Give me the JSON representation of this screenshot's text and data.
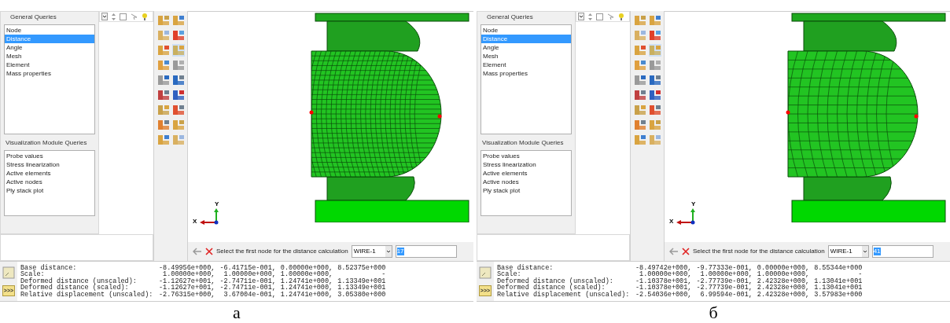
{
  "panels": [
    {
      "caption": "а",
      "general_queries": {
        "title": "General Queries",
        "items": [
          {
            "label": "Node",
            "selected": false
          },
          {
            "label": "Distance",
            "selected": true
          },
          {
            "label": "Angle",
            "selected": false
          },
          {
            "label": "Mesh",
            "selected": false
          },
          {
            "label": "Element",
            "selected": false
          },
          {
            "label": "Mass properties",
            "selected": false
          }
        ]
      },
      "visualization_queries": {
        "title": "Visualization Module Queries",
        "items": [
          {
            "label": "Probe values"
          },
          {
            "label": "Stress linearization"
          },
          {
            "label": "Active elements"
          },
          {
            "label": "Active nodes"
          },
          {
            "label": "Ply stack plot"
          }
        ]
      },
      "axes": {
        "x": "X",
        "y": "Y"
      },
      "prompt": {
        "text": "Select the first node for the distance calculation",
        "dropdown": "WIRE-1",
        "input": "17"
      },
      "output_button": ">>>",
      "output": [
        {
          "label": "Base distance:",
          "values": [
            "-8.49956e+000,",
            "-6.41715e-001,",
            "0.00000e+000,",
            "8.52375e+000"
          ]
        },
        {
          "label": "Scale:",
          "values": [
            "1.00000e+000,",
            "1.00000e+000,",
            "1.00000e+000,",
            "-"
          ]
        },
        {
          "label": "Deformed distance (unscaled):",
          "values": [
            "-1.12627e+001,",
            "-2.74711e-001,",
            "1.24741e+000,",
            "1.13349e+001"
          ]
        },
        {
          "label": "Deformed distance (scaled):",
          "values": [
            "-1.12627e+001,",
            "-2.74711e-001,",
            "1.24741e+000,",
            "1.13349e+001"
          ]
        },
        {
          "label": "Relative displacement (unscaled):",
          "values": [
            "-2.76315e+000,",
            "3.67004e-001,",
            "1.24741e+000,",
            "3.05380e+000"
          ]
        }
      ]
    },
    {
      "caption": "б",
      "general_queries": {
        "title": "General Queries",
        "items": [
          {
            "label": "Node",
            "selected": false
          },
          {
            "label": "Distance",
            "selected": true
          },
          {
            "label": "Angle",
            "selected": false
          },
          {
            "label": "Mesh",
            "selected": false
          },
          {
            "label": "Element",
            "selected": false
          },
          {
            "label": "Mass properties",
            "selected": false
          }
        ]
      },
      "visualization_queries": {
        "title": "Visualization Module Queries",
        "items": [
          {
            "label": "Probe values"
          },
          {
            "label": "Stress linearization"
          },
          {
            "label": "Active elements"
          },
          {
            "label": "Active nodes"
          },
          {
            "label": "Ply stack plot"
          }
        ]
      },
      "axes": {
        "x": "X",
        "y": "Y"
      },
      "prompt": {
        "text": "Select the first node for the distance calculation",
        "dropdown": "WIRE-1",
        "input": "41"
      },
      "output_button": ">>>",
      "output": [
        {
          "label": "Base distance:",
          "values": [
            "-8.49742e+000,",
            "-9.77333e-001,",
            "0.00000e+000,",
            "8.55344e+000"
          ]
        },
        {
          "label": "Scale:",
          "values": [
            "1.00000e+000,",
            "1.00000e+000,",
            "1.00000e+000,",
            "-"
          ]
        },
        {
          "label": "Deformed distance (unscaled):",
          "values": [
            "-1.10378e+001,",
            "-2.77739e-001,",
            "2.42328e+000,",
            "1.13041e+001"
          ]
        },
        {
          "label": "Deformed distance (scaled):",
          "values": [
            "-1.10378e+001,",
            "-2.77739e-001,",
            "2.42328e+000,",
            "1.13041e+001"
          ]
        },
        {
          "label": "Relative displacement (unscaled):",
          "values": [
            "-2.54036e+000,",
            "6.99594e-001,",
            "2.42328e+000,",
            "3.57983e+000"
          ]
        }
      ]
    }
  ]
}
